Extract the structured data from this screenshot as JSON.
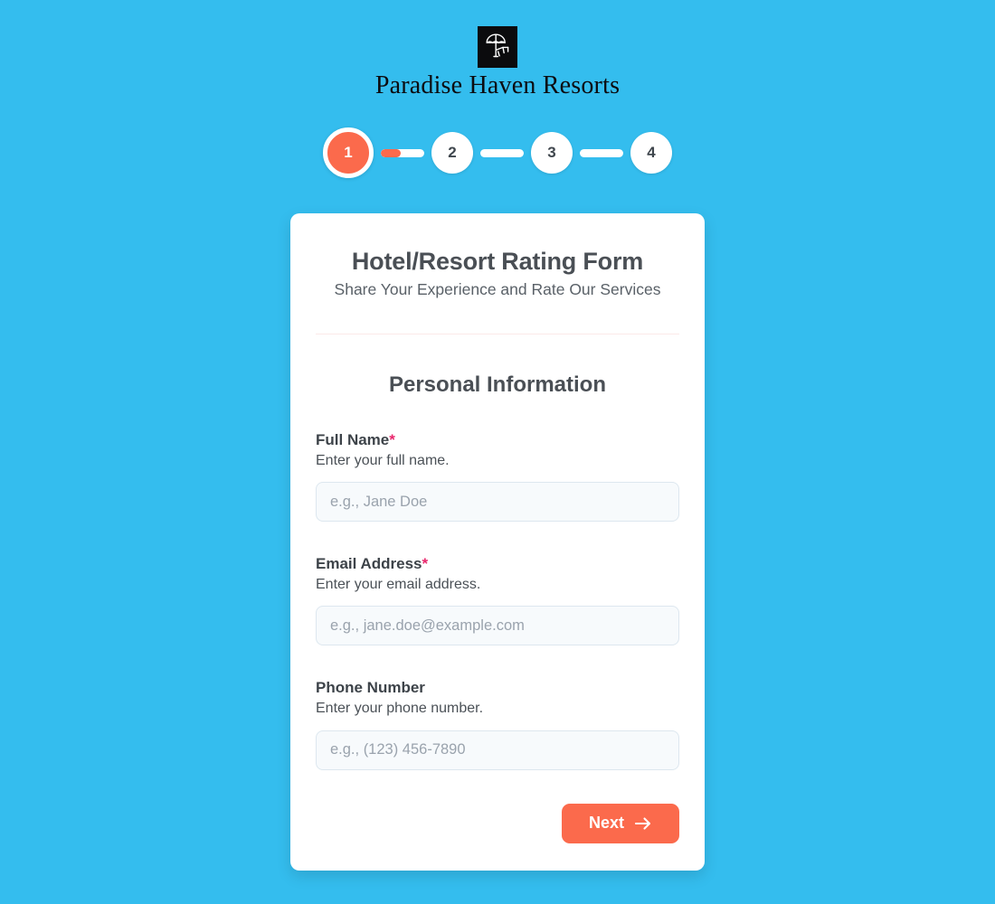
{
  "theme": {
    "background": "#34bdee",
    "accent": "#fb6a4c",
    "card_background": "#ffffff",
    "required_marker": "#e8256b",
    "input_background": "#f7fafc",
    "input_border": "#dde7ef",
    "heading_text": "#4a4f55"
  },
  "brand": {
    "logo_icon": "beach-umbrella-chair-icon",
    "name": "Paradise Haven Resorts"
  },
  "stepper": {
    "current_step": 1,
    "steps": [
      {
        "label": "1",
        "state": "active"
      },
      {
        "label": "2",
        "state": "inactive"
      },
      {
        "label": "3",
        "state": "inactive"
      },
      {
        "label": "4",
        "state": "inactive"
      }
    ],
    "connectors": [
      {
        "fill_percent": 46
      },
      {
        "fill_percent": 0
      },
      {
        "fill_percent": 0
      }
    ]
  },
  "form": {
    "title": "Hotel/Resort Rating Form",
    "subtitle": "Share Your Experience and Rate Our Services",
    "section_title": "Personal Information",
    "fields": [
      {
        "label": "Full Name",
        "required": true,
        "required_mark": "*",
        "help": "Enter your full name.",
        "placeholder": "e.g., Jane Doe",
        "value": ""
      },
      {
        "label": "Email Address",
        "required": true,
        "required_mark": "*",
        "help": "Enter your email address.",
        "placeholder": "e.g., jane.doe@example.com",
        "value": ""
      },
      {
        "label": "Phone Number",
        "required": false,
        "required_mark": "",
        "help": "Enter your phone number.",
        "placeholder": "e.g., (123) 456-7890",
        "value": ""
      }
    ],
    "next_button": {
      "label": "Next",
      "icon": "arrow-right-icon"
    }
  }
}
